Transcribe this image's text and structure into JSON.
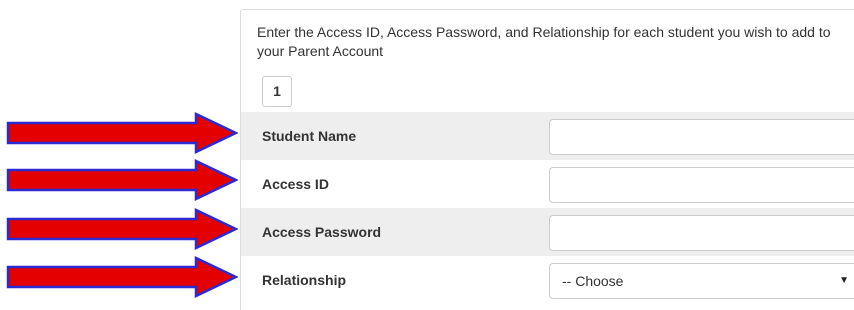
{
  "instructions": "Enter the Access ID, Access Password, and Relationship for each student you wish to add to your Parent Account",
  "student_tab": "1",
  "fields": [
    {
      "label": "Student Name",
      "value": ""
    },
    {
      "label": "Access ID",
      "value": ""
    },
    {
      "label": "Access Password",
      "value": ""
    },
    {
      "label": "Relationship",
      "selected": "-- Choose",
      "caret": "▼"
    }
  ],
  "colors": {
    "arrow_fill": "#e40000",
    "arrow_outline": "#2b2bd6",
    "row_shade": "#eeeeee",
    "border": "#cccccc"
  },
  "icons": [
    "arrow-right-icon",
    "dropdown-caret-icon"
  ]
}
